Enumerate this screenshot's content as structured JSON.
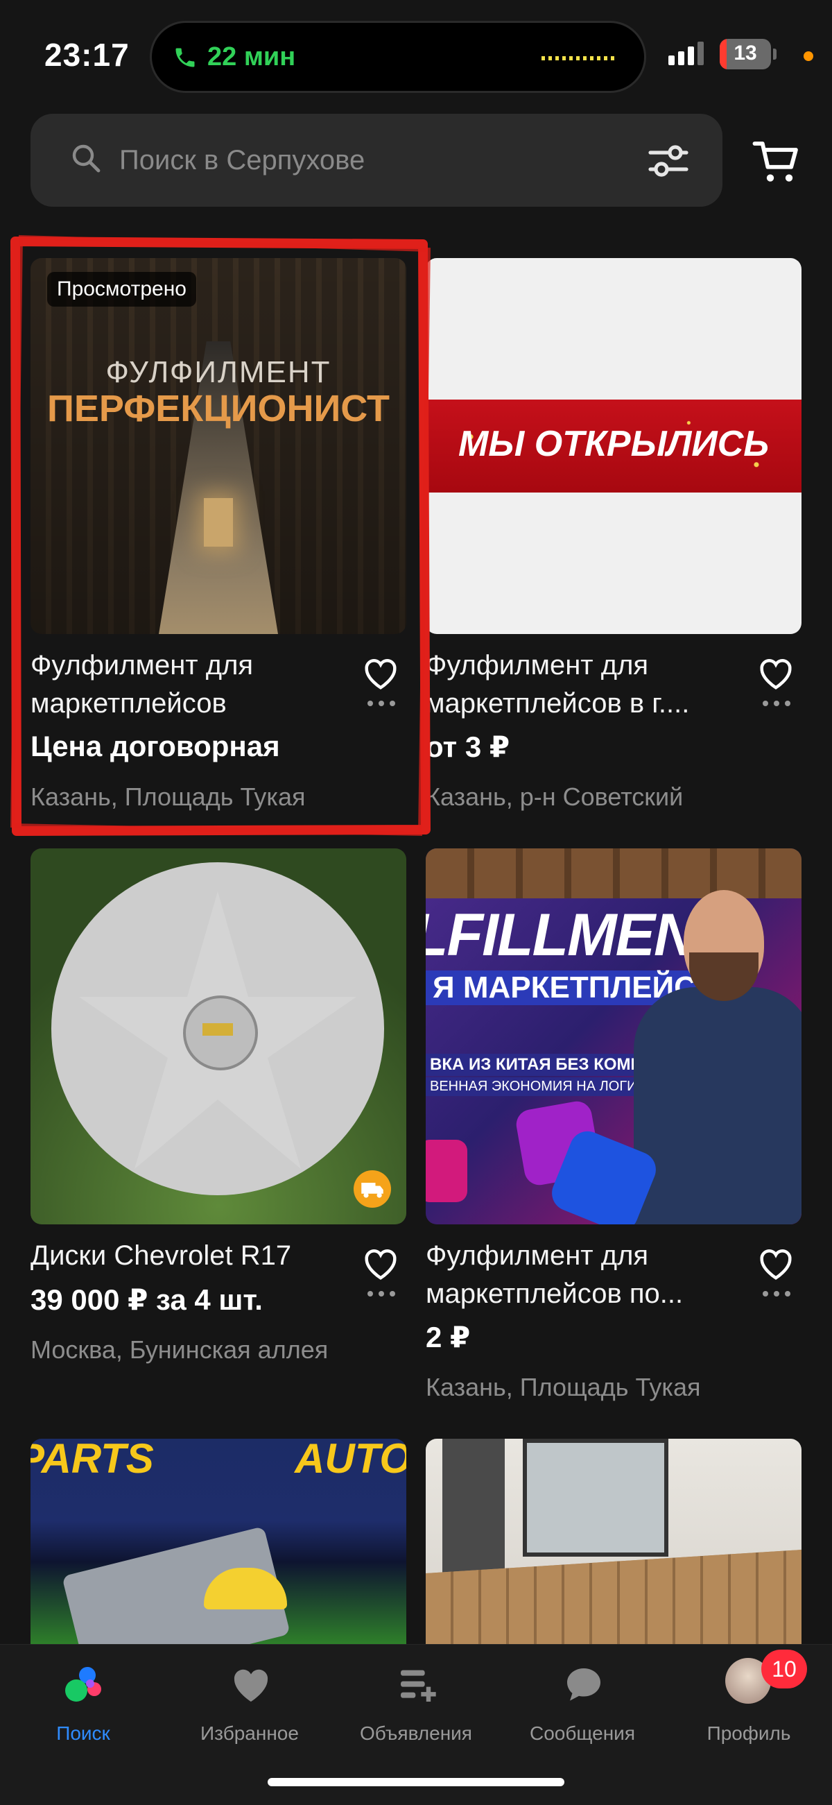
{
  "status_bar": {
    "time": "23:17",
    "call_duration": "22 мин",
    "battery_level": "13"
  },
  "search": {
    "placeholder": "Поиск в Серпухове"
  },
  "listings": [
    {
      "badge": "Просмотрено",
      "image_text_line1": "ФУЛФИЛМЕНТ",
      "image_text_line2": "ПЕРФЕКЦИОНИСТ",
      "title": "Фулфилмент для маркетплейсов",
      "price": "Цена договорная",
      "location": "Казань, Площадь Тукая"
    },
    {
      "image_text_line1": "МЫ ОТКРЫЛИСЬ",
      "title": "Фулфилмент для маркетплейсов в г....",
      "price": "от 3 ₽",
      "location": "Казань, р-н Советский"
    },
    {
      "title": "Диски Chevrolet R17",
      "price": "39 000 ₽ за 4 шт.",
      "location": "Москва, Бунинская аллея"
    },
    {
      "image_text_line1": "LFILLMENT",
      "image_text_line2": "Я МАРКЕТПЛЕЙСОВ",
      "image_text_line3": "ВКА ИЗ КИТАЯ БЕЗ КОМИССИЙ",
      "image_text_line4": "ВЕННАЯ ЭКОНОМИЯ НА ЛОГИСТИКЕ",
      "title": "Фулфилмент для маркетплейсов по...",
      "price": "2 ₽",
      "location": "Казань, Площадь Тукая"
    },
    {
      "image_text_line1": "PARTS",
      "image_text_line2": "AUTO"
    },
    {}
  ],
  "tabbar": {
    "tabs": [
      {
        "label": "Поиск",
        "icon": "search-dots-icon",
        "active": true
      },
      {
        "label": "Избранное",
        "icon": "heart-icon",
        "active": false
      },
      {
        "label": "Объявления",
        "icon": "add-listing-icon",
        "active": false
      },
      {
        "label": "Сообщения",
        "icon": "chat-bubble-icon",
        "active": false
      },
      {
        "label": "Профиль",
        "icon": "avatar",
        "active": false
      }
    ],
    "profile_badge": "10"
  },
  "colors": {
    "background": "#151515",
    "accent": "#2f8cff",
    "call_green": "#31d158",
    "badge_red": "#ff2b3b"
  }
}
